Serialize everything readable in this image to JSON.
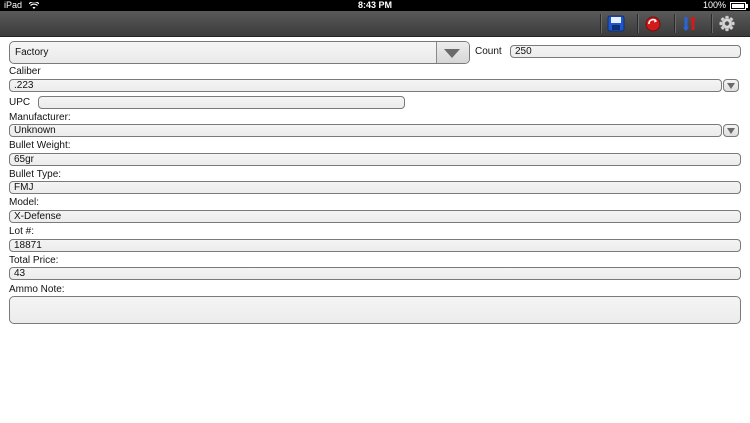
{
  "status": {
    "device": "iPad",
    "time": "8:43 PM",
    "battery": "100%"
  },
  "toolbar": {
    "save_icon": "save-icon",
    "refresh_icon": "refresh-icon",
    "sort_icon": "sort-icon",
    "settings_icon": "gear-icon"
  },
  "form": {
    "type_selected": "Factory",
    "count_label": "Count",
    "count_value": "250",
    "caliber_label": "Caliber",
    "caliber_value": ".223",
    "upc_label": "UPC",
    "upc_value": "",
    "manufacturer_label": "Manufacturer:",
    "manufacturer_value": "Unknown",
    "bullet_weight_label": "Bullet Weight:",
    "bullet_weight_value": "65gr",
    "bullet_type_label": "Bullet Type:",
    "bullet_type_value": "FMJ",
    "model_label": "Model:",
    "model_value": "X-Defense",
    "lot_label": "Lot #:",
    "lot_value": "18871",
    "total_price_label": "Total Price:",
    "total_price_value": "43",
    "ammo_note_label": "Ammo Note:",
    "ammo_note_value": ""
  }
}
